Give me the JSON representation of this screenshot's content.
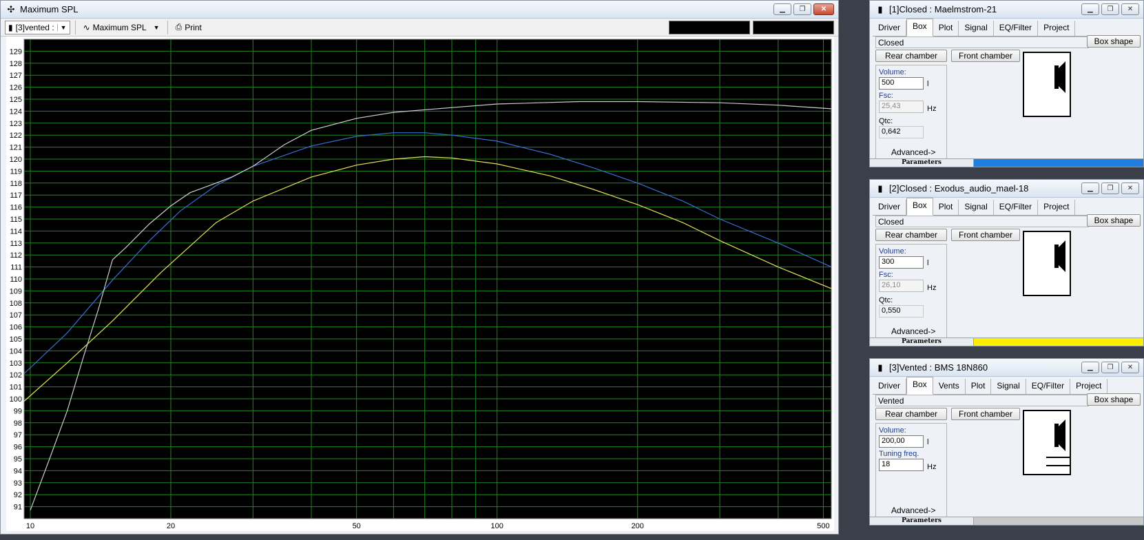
{
  "main": {
    "title": "Maximum SPL",
    "toolbar": {
      "project_combo": "[3]vented :",
      "graph_combo": "Maximum SPL",
      "print_label": "Print"
    }
  },
  "chart_data": {
    "type": "line",
    "xscale": "log",
    "xlim": [
      9.7,
      520
    ],
    "ylim": [
      90,
      130
    ],
    "x_ticks": [
      10,
      20,
      50,
      100,
      200,
      500
    ],
    "x_ticks_minor": [
      30,
      40,
      60,
      70,
      80,
      90,
      300,
      400
    ],
    "y_ticks": [
      91,
      92,
      93,
      94,
      95,
      96,
      97,
      98,
      99,
      100,
      101,
      102,
      103,
      104,
      105,
      106,
      107,
      108,
      109,
      110,
      111,
      112,
      113,
      114,
      115,
      116,
      117,
      118,
      119,
      120,
      121,
      122,
      123,
      124,
      125,
      126,
      127,
      128,
      129
    ],
    "grid": true,
    "background": "#000000",
    "grid_color": "#1f8a1f",
    "series": [
      {
        "color": "#3a6fd8",
        "x": [
          9.7,
          12,
          15,
          18,
          21,
          25,
          30,
          40,
          50,
          60,
          70,
          80,
          100,
          130,
          160,
          200,
          250,
          300,
          400,
          520
        ],
        "y": [
          102.1,
          105.5,
          109.9,
          113.2,
          115.7,
          117.8,
          119.4,
          121.1,
          121.9,
          122.2,
          122.2,
          122.0,
          121.5,
          120.4,
          119.3,
          118.0,
          116.5,
          115.0,
          113.0,
          111.0
        ]
      },
      {
        "color": "#e4e45a",
        "x": [
          9.7,
          12,
          15,
          19,
          25,
          30,
          40,
          50,
          60,
          70,
          80,
          100,
          130,
          160,
          200,
          250,
          300,
          400,
          520
        ],
        "y": [
          99.8,
          103.0,
          106.5,
          110.5,
          114.7,
          116.5,
          118.5,
          119.5,
          120.0,
          120.2,
          120.1,
          119.6,
          118.6,
          117.5,
          116.2,
          114.7,
          113.2,
          111.0,
          109.2
        ]
      },
      {
        "color": "#cfcfcf",
        "x": [
          10,
          11,
          12,
          13,
          14,
          15,
          16,
          18,
          20,
          22,
          25,
          27,
          30,
          35,
          40,
          50,
          60,
          80,
          100,
          150,
          200,
          300,
          400,
          520
        ],
        "y": [
          90.7,
          95.0,
          99.0,
          103.5,
          107.5,
          111.6,
          112.6,
          114.6,
          116.1,
          117.2,
          118.0,
          118.5,
          119.4,
          121.2,
          122.4,
          123.4,
          123.9,
          124.3,
          124.6,
          124.8,
          124.8,
          124.7,
          124.5,
          124.2
        ]
      }
    ]
  },
  "panels": [
    {
      "title": "[1]Closed : Maelmstrom-21",
      "tabs": [
        "Driver",
        "Box",
        "Plot",
        "Signal",
        "EQ/Filter",
        "Project"
      ],
      "active_tab": "Box",
      "box_type": "Closed",
      "box_shape_label": "Box shape",
      "rear_chamber_label": "Rear chamber",
      "front_chamber_label": "Front chamber",
      "f1_label": "Volume:",
      "f1_value": "500",
      "f1_unit": "l",
      "f2_label": "Fsc:",
      "f2_value": "25,43",
      "f2_unit": "Hz",
      "f3_label": "Qtc:",
      "f3_value": "0,642",
      "advanced_label": "Advanced->",
      "status_label": "Parameters",
      "status_color": "#1e7fe0"
    },
    {
      "title": "[2]Closed : Exodus_audio_mael-18",
      "tabs": [
        "Driver",
        "Box",
        "Plot",
        "Signal",
        "EQ/Filter",
        "Project"
      ],
      "active_tab": "Box",
      "box_type": "Closed",
      "box_shape_label": "Box shape",
      "rear_chamber_label": "Rear chamber",
      "front_chamber_label": "Front chamber",
      "f1_label": "Volume:",
      "f1_value": "300",
      "f1_unit": "l",
      "f2_label": "Fsc:",
      "f2_value": "26,10",
      "f2_unit": "Hz",
      "f3_label": "Qtc:",
      "f3_value": "0,550",
      "advanced_label": "Advanced->",
      "status_label": "Parameters",
      "status_color": "#ffee00"
    },
    {
      "title": "[3]Vented : BMS 18N860",
      "tabs": [
        "Driver",
        "Box",
        "Vents",
        "Plot",
        "Signal",
        "EQ/Filter",
        "Project"
      ],
      "active_tab": "Box",
      "box_type": "Vented",
      "box_shape_label": "Box shape",
      "rear_chamber_label": "Rear chamber",
      "front_chamber_label": "Front chamber",
      "f1_label": "Volume:",
      "f1_value": "200,00",
      "f1_unit": "l",
      "f2_label": "Tuning freq.",
      "f2_value": "18",
      "f2_unit": "Hz",
      "advanced_label": "Advanced->",
      "status_label": "Parameters",
      "status_color": "#c8c8c8"
    }
  ]
}
